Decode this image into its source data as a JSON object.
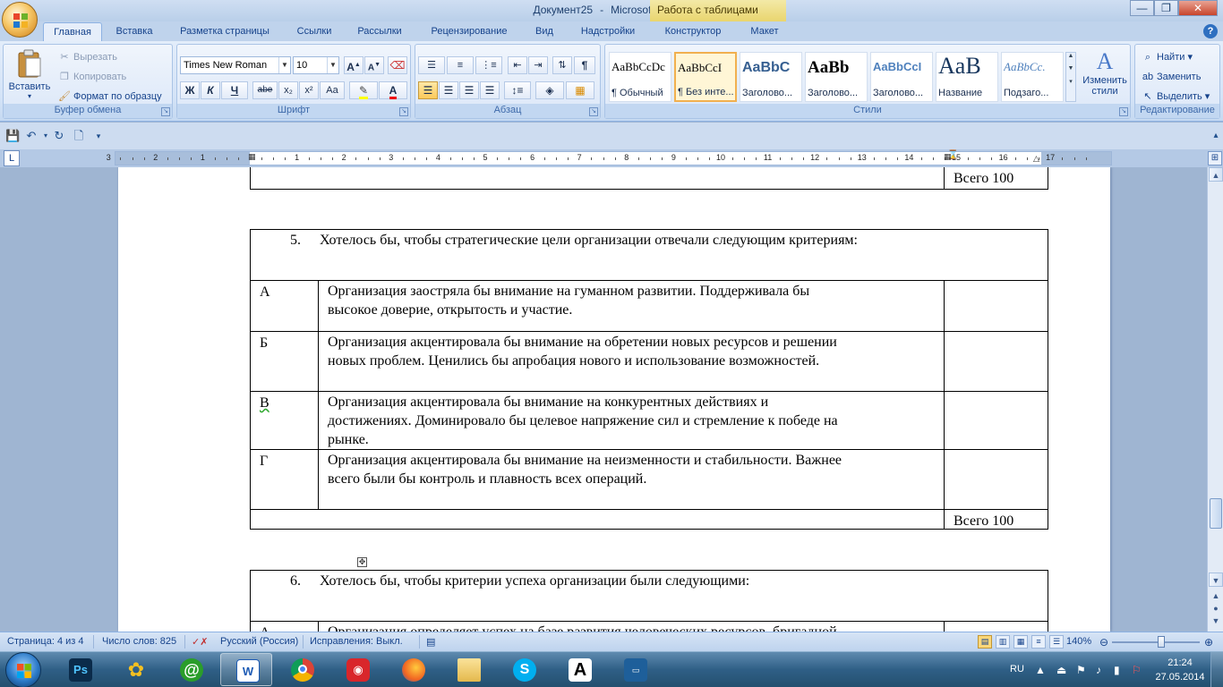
{
  "window": {
    "title_doc": "Документ25",
    "title_sep": "-",
    "title_app": "Microsoft Word",
    "contextual_header": "Работа с таблицами",
    "min_glyph": "—",
    "max_glyph": "❐",
    "close_glyph": "✕"
  },
  "tabs": [
    "Главная",
    "Вставка",
    "Разметка страницы",
    "Ссылки",
    "Рассылки",
    "Рецензирование",
    "Вид",
    "Надстройки",
    "Конструктор",
    "Макет"
  ],
  "ribbon": {
    "clipboard": {
      "paste": "Вставить",
      "cut": "Вырезать",
      "copy": "Копировать",
      "format_painter": "Формат по образцу",
      "label": "Буфер обмена"
    },
    "font": {
      "name": "Times New Roman",
      "size": "10",
      "label": "Шрифт",
      "bold": "Ж",
      "italic": "К",
      "underline": "Ч",
      "strike": "abe",
      "sub": "x₂",
      "sup": "x²",
      "case": "Aa",
      "grow": "A",
      "shrink": "A"
    },
    "paragraph": {
      "label": "Абзац"
    },
    "styles": {
      "label": "Стили",
      "items": [
        {
          "preview": "AaBbCcDc",
          "name": "¶ Обычный"
        },
        {
          "preview": "AaBbCcI",
          "name": "¶ Без инте..."
        },
        {
          "preview": "AaBbC",
          "name": "Заголово..."
        },
        {
          "preview": "AaBb",
          "name": "Заголово..."
        },
        {
          "preview": "AaBbCcI",
          "name": "Заголово..."
        },
        {
          "preview": "AaB",
          "name": "Название"
        },
        {
          "preview": "AaBbCc.",
          "name": "Подзаго..."
        }
      ],
      "change": "Изменить стили"
    },
    "editing": {
      "find": "Найти",
      "replace": "Заменить",
      "select": "Выделить",
      "label": "Редактирование"
    }
  },
  "ruler": {
    "left_numbers": [
      "3",
      "2",
      "1"
    ],
    "right_numbers": [
      "1",
      "2",
      "3",
      "4",
      "5",
      "6",
      "7",
      "8",
      "9",
      "10",
      "11",
      "12",
      "13",
      "14",
      "15",
      "16",
      "17"
    ],
    "tab_selector": "L"
  },
  "document": {
    "total_label_1": "Всего 100",
    "q5": {
      "number": "5.",
      "text": "Хотелось бы, чтобы стратегические цели организации отвечали следующим критериям:"
    },
    "rows": [
      {
        "letter": "А",
        "lines": [
          "Организация заостряла бы внимание на гуманном развитии. Поддерживала бы",
          "высокое доверие, открытость и участие."
        ]
      },
      {
        "letter": "Б",
        "lines": [
          "Организация акцентировала бы  внимание на обретении новых ресурсов и решении",
          "новых проблем. Ценились бы апробация нового и использование возможностей."
        ]
      },
      {
        "letter": "В",
        "lines": [
          "Организация акцентировала бы  внимание на конкурентных действиях и",
          "достижениях. Доминировало бы целевое напряжение сил и стремление к победе на",
          "рынке."
        ]
      },
      {
        "letter": "Г",
        "lines": [
          "Организация акцентировала бы  внимание на неизменности и  стабильности. Важнее",
          "всего  были бы контроль и плавность всех операций."
        ]
      }
    ],
    "total_label_2": "Всего 100",
    "q6": {
      "number": "6.",
      "text": "Хотелось бы, чтобы критерии успеха организации были следующими:"
    },
    "partial_letter": "А",
    "partial_text": "Организация определяет успех на базе развития человеческих ресурсов, бригадной"
  },
  "statusbar": {
    "page": "Страница: 4 из 4",
    "words": "Число слов: 825",
    "language": "Русский (Россия)",
    "track": "Исправления: Выкл.",
    "zoom": "140%"
  },
  "taskbar": {
    "lang": "RU",
    "time": "21:24",
    "date": "27.05.2014",
    "apps": [
      "Photoshop",
      "ICQ",
      "Mail.ru Agent",
      "Microsoft Word",
      "Google Chrome",
      "Screen Recorder",
      "Firefox",
      "Проводник",
      "Skype",
      "Adobe Reader",
      "TXT.RU"
    ]
  }
}
